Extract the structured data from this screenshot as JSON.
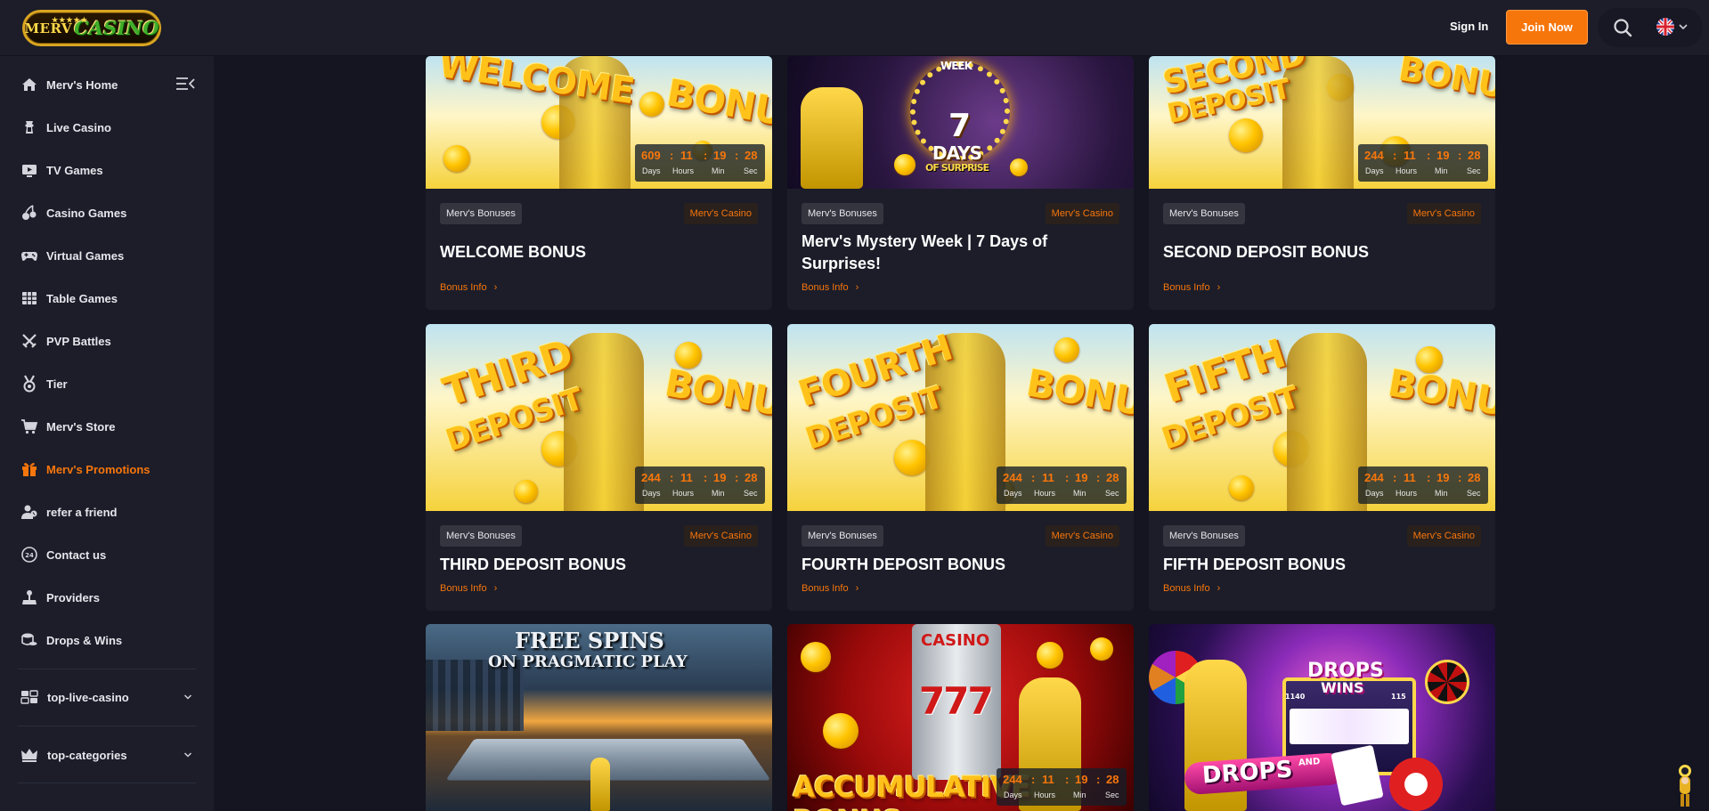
{
  "header": {
    "logo_left": "MERV",
    "logo_right": "CASINO",
    "logo_stars": "★★★★★",
    "sign_in": "Sign In",
    "join_now": "Join Now"
  },
  "sidebar": {
    "items": [
      {
        "label": "Merv's Home",
        "icon": "home-icon"
      },
      {
        "label": "Live Casino",
        "icon": "dealer-icon"
      },
      {
        "label": "TV Games",
        "icon": "tv-icon"
      },
      {
        "label": "Casino Games",
        "icon": "cherries-icon"
      },
      {
        "label": "Virtual Games",
        "icon": "gamepad-icon"
      },
      {
        "label": "Table Games",
        "icon": "table-grid-icon"
      },
      {
        "label": "PVP Battles",
        "icon": "crossed-swords-icon"
      },
      {
        "label": "Tier",
        "icon": "medal-icon"
      },
      {
        "label": "Merv's Store",
        "icon": "cart-icon"
      },
      {
        "label": "Merv's Promotions",
        "icon": "gift-icon",
        "active": true
      },
      {
        "label": "refer a friend",
        "icon": "users-icon"
      },
      {
        "label": "Contact us",
        "icon": "support-24-icon"
      },
      {
        "label": "Providers",
        "icon": "joystick-icon"
      },
      {
        "label": "Drops & Wins",
        "icon": "coins-icon"
      }
    ],
    "dropdowns": [
      {
        "label": "top-live-casino",
        "icon": "cards-icon"
      },
      {
        "label": "top-categories",
        "icon": "crown-icon"
      }
    ],
    "active_color": "#f7760c"
  },
  "promotions": [
    {
      "category": "Merv's Bonuses",
      "brand": "Merv's Casino",
      "title": "WELCOME BONUS",
      "info": "Bonus Info",
      "arrow": "›",
      "art_line1": "WELCOME",
      "art_line2": "BONUS",
      "countdown": {
        "days": "609",
        "hours": "11",
        "min": "19",
        "sec": "28"
      }
    },
    {
      "category": "Merv's Bonuses",
      "brand": "Merv's Casino",
      "title": "Merv's Mystery Week | 7 Days of Surprises!",
      "info": "Bonus Info",
      "arrow": "›",
      "art_line1": "7",
      "art_line2": "DAYS",
      "art_line3": "OF SURPRISE",
      "art_top": "WEEK"
    },
    {
      "category": "Merv's Bonuses",
      "brand": "Merv's Casino",
      "title": "SECOND DEPOSIT BONUS",
      "info": "Bonus Info",
      "arrow": "›",
      "art_line1": "SECOND",
      "art_line2": "DEPOSIT",
      "art_line3": "BONUS",
      "countdown": {
        "days": "244",
        "hours": "11",
        "min": "19",
        "sec": "28"
      }
    },
    {
      "category": "Merv's Bonuses",
      "brand": "Merv's Casino",
      "title": "THIRD DEPOSIT BONUS",
      "info": "Bonus Info",
      "arrow": "›",
      "art_line1": "THIRD",
      "art_line2": "DEPOSIT",
      "art_line3": "BONUS",
      "countdown": {
        "days": "244",
        "hours": "11",
        "min": "19",
        "sec": "28"
      }
    },
    {
      "category": "Merv's Bonuses",
      "brand": "Merv's Casino",
      "title": "FOURTH DEPOSIT BONUS",
      "info": "Bonus Info",
      "arrow": "›",
      "art_line1": "FOURTH",
      "art_line2": "DEPOSIT",
      "art_line3": "BONUS",
      "countdown": {
        "days": "244",
        "hours": "11",
        "min": "19",
        "sec": "28"
      }
    },
    {
      "category": "Merv's Bonuses",
      "brand": "Merv's Casino",
      "title": "FIFTH DEPOSIT BONUS",
      "info": "Bonus Info",
      "arrow": "›",
      "art_line1": "FIFTH",
      "art_line2": "DEPOSIT",
      "art_line3": "BONUS",
      "countdown": {
        "days": "244",
        "hours": "11",
        "min": "19",
        "sec": "28"
      }
    },
    {
      "art_line1": "FREE SPINS",
      "art_line2": "ON PRAGMATIC PLAY"
    },
    {
      "art_line1": "CASINO",
      "art_line2": "ACCUMULATIVE BONUS",
      "art_line3": "777",
      "countdown": {
        "days": "244",
        "hours": "11",
        "min": "19",
        "sec": "28"
      }
    },
    {
      "art_line1": "DROPS",
      "art_line2": "WINS",
      "art_line3": "DROPS",
      "art_line4": "AND",
      "art_amt1": "1140",
      "art_amt2": "115"
    }
  ],
  "countdown_labels": {
    "days": "Days",
    "hours": "Hours",
    "min": "Min",
    "sec": "Sec",
    "sep": ":"
  },
  "colors": {
    "accent": "#f7760c",
    "background": "#141520",
    "panel": "#1c1d29"
  }
}
